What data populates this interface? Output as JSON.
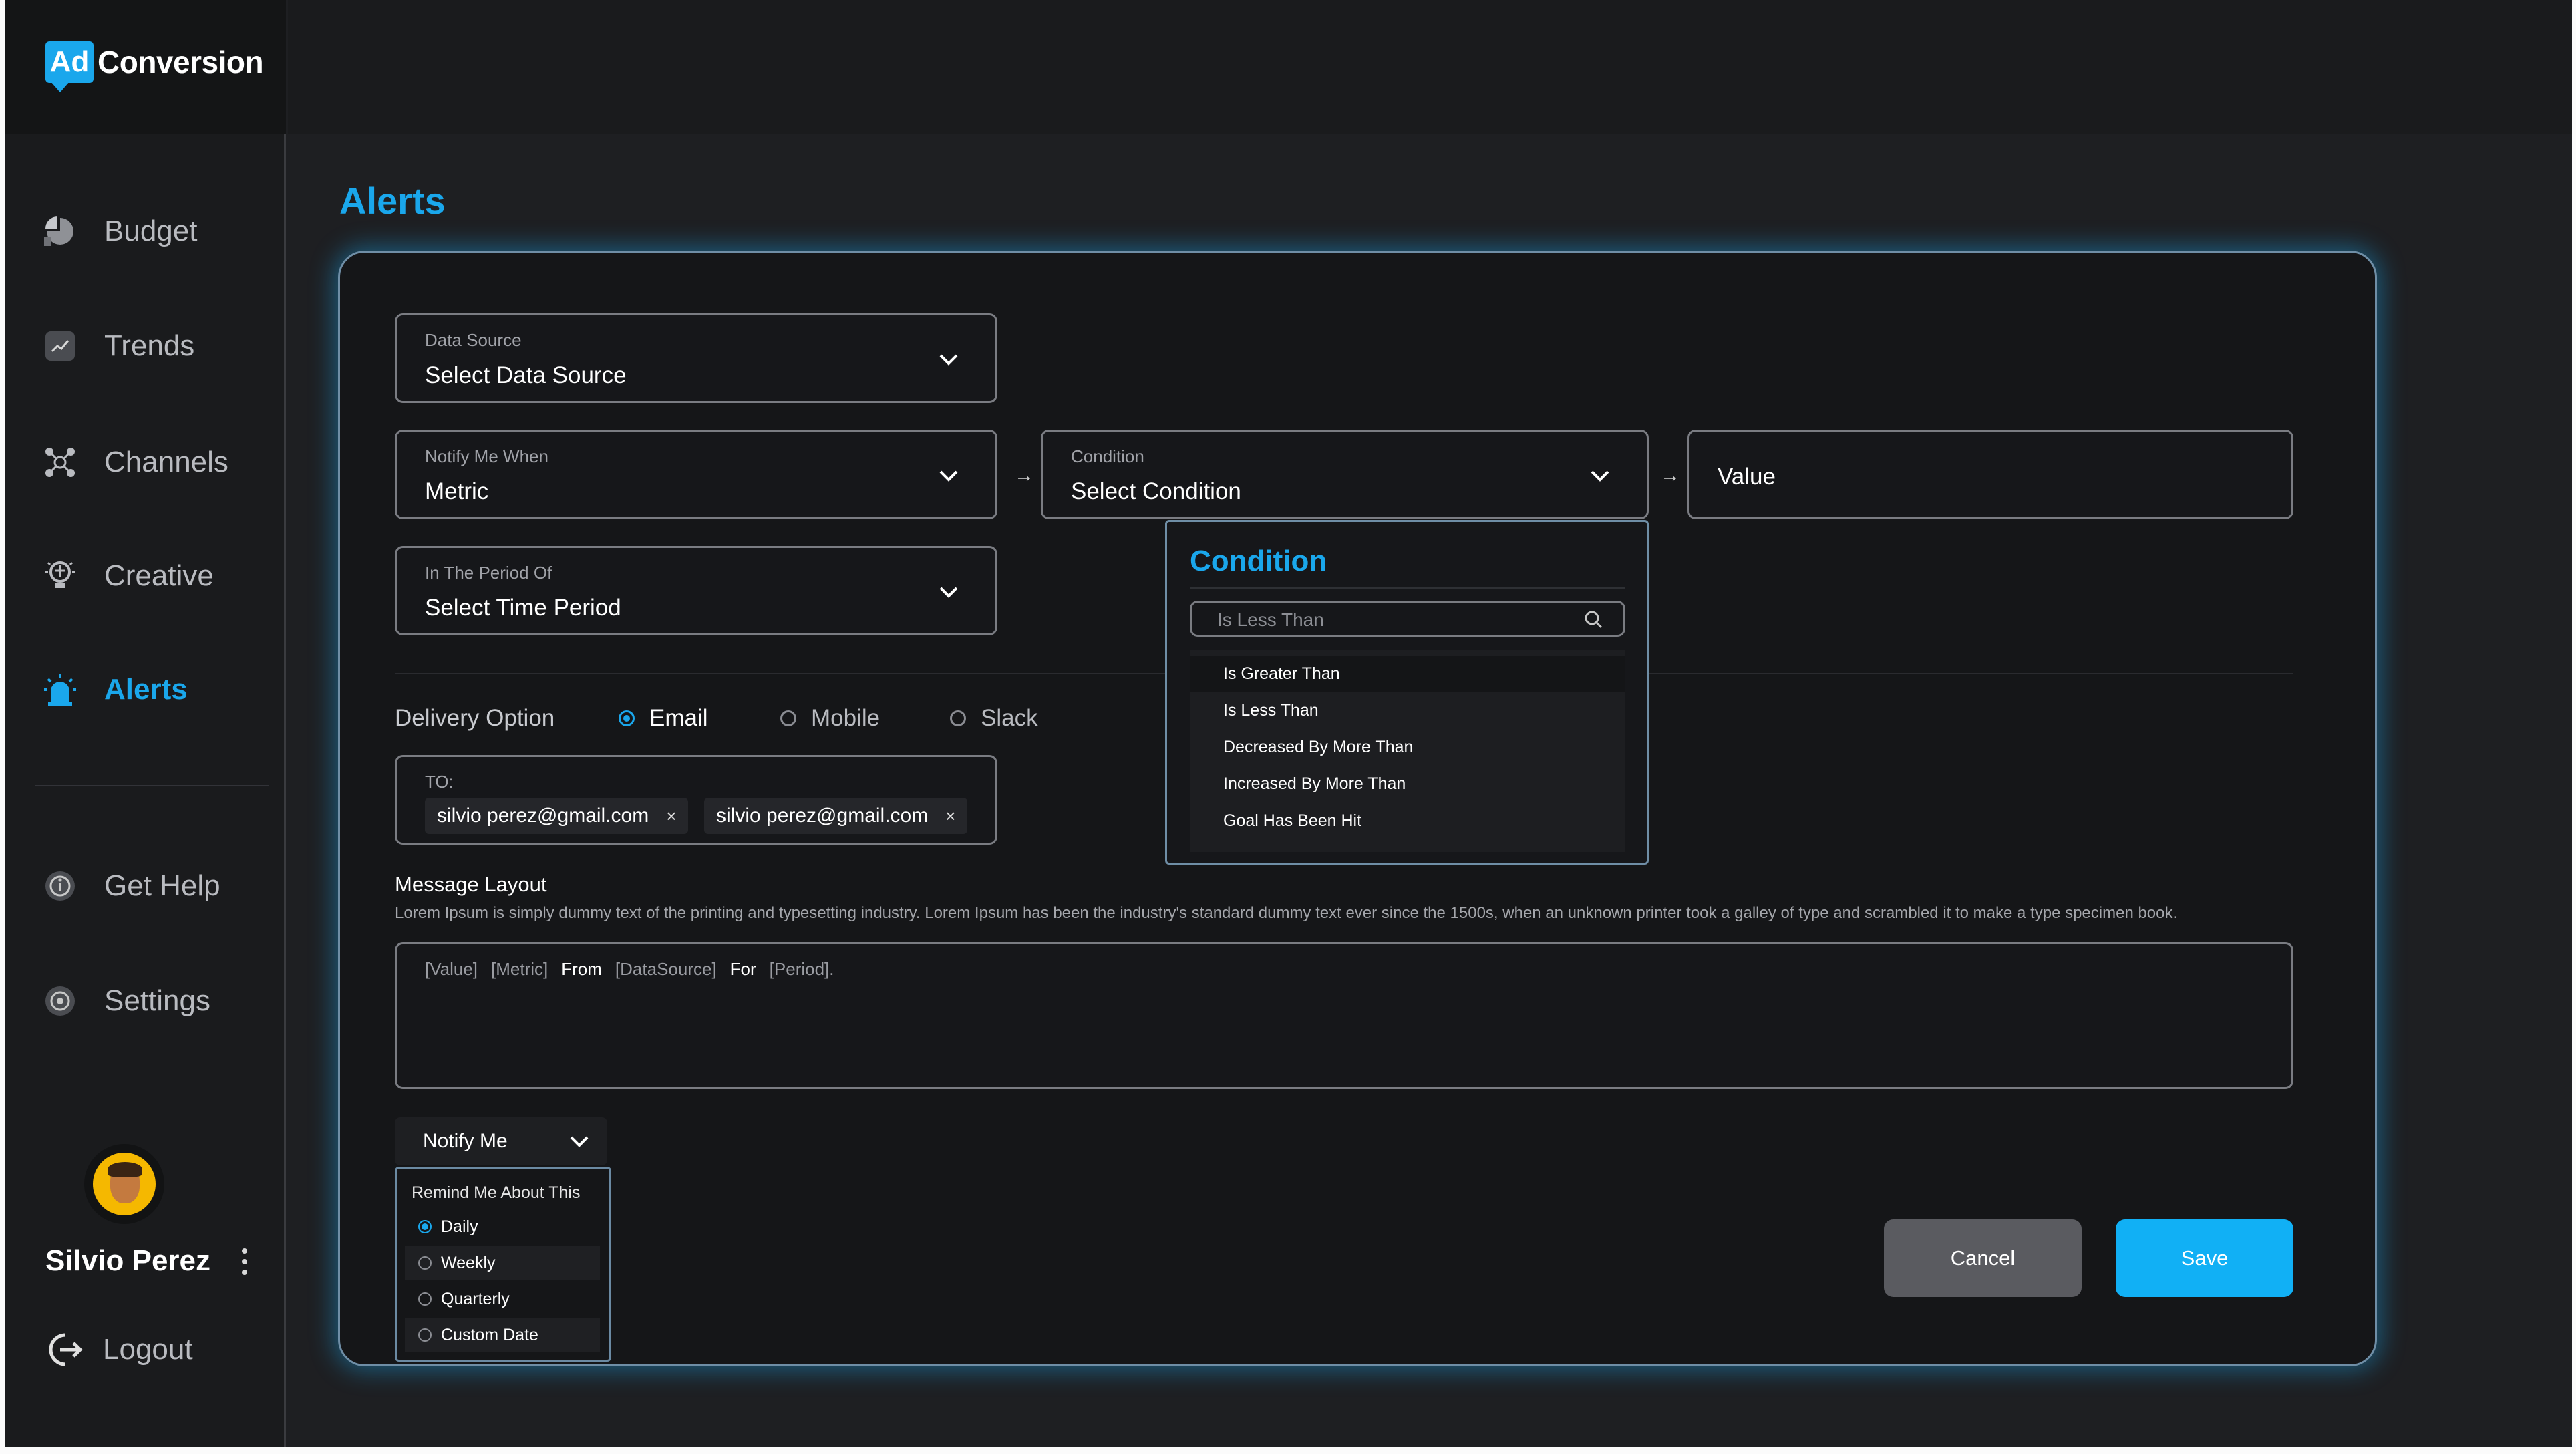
{
  "brand": {
    "badge": "Ad",
    "name": "Conversion",
    "accent": "#1aa7ec"
  },
  "sidebar": {
    "items": [
      {
        "label": "Budget",
        "icon": "pie-chart-icon"
      },
      {
        "label": "Trends",
        "icon": "trend-icon"
      },
      {
        "label": "Channels",
        "icon": "channels-icon"
      },
      {
        "label": "Creative",
        "icon": "bulb-icon"
      },
      {
        "label": "Alerts",
        "icon": "alarm-icon",
        "active": true
      }
    ],
    "secondary": [
      {
        "label": "Get Help",
        "icon": "info-icon"
      },
      {
        "label": "Settings",
        "icon": "settings-icon"
      }
    ],
    "user": {
      "name": "Silvio Perez"
    },
    "logout": "Logout"
  },
  "page": {
    "title": "Alerts"
  },
  "form": {
    "data_source": {
      "label": "Data Source",
      "value": "Select Data Source"
    },
    "notify_when": {
      "label": "Notify Me When",
      "value": "Metric"
    },
    "condition": {
      "label": "Condition",
      "value": "Select Condition"
    },
    "value": {
      "placeholder": "Value"
    },
    "period": {
      "label": "In The Period Of",
      "value": "Select Time Period"
    },
    "arrow": "→",
    "delivery": {
      "label": "Delivery Option",
      "options": [
        "Email",
        "Mobile",
        "Slack"
      ],
      "selected": "Email"
    },
    "to": {
      "label": "TO:",
      "chips": [
        "silvio perez@gmail.com",
        "silvio perez@gmail.com"
      ],
      "remove_glyph": "×"
    },
    "message": {
      "title": "Message Layout",
      "description": "Lorem Ipsum is simply dummy text of the printing and typesetting industry. Lorem Ipsum has been the industry's standard dummy text ever since the 1500s, when an unknown printer took a galley of type and scrambled it to make a type specimen book.",
      "template": [
        "[Value]",
        "[Metric]",
        "From",
        "[DataSource]",
        "For",
        "[Period]."
      ]
    },
    "notify": {
      "button": "Notify Me",
      "remind_title": "Remind Me About This",
      "options": [
        "Daily",
        "Weekly",
        "Quarterly",
        "Custom Date"
      ],
      "selected": "Daily"
    }
  },
  "condition_dropdown": {
    "title": "Condition",
    "search_value": "Is Less Than",
    "options": [
      "Is Greater Than",
      "Is Less Than",
      "Decreased By More Than",
      "Increased By More Than",
      "Goal Has Been Hit"
    ]
  },
  "actions": {
    "cancel": "Cancel",
    "save": "Save"
  }
}
